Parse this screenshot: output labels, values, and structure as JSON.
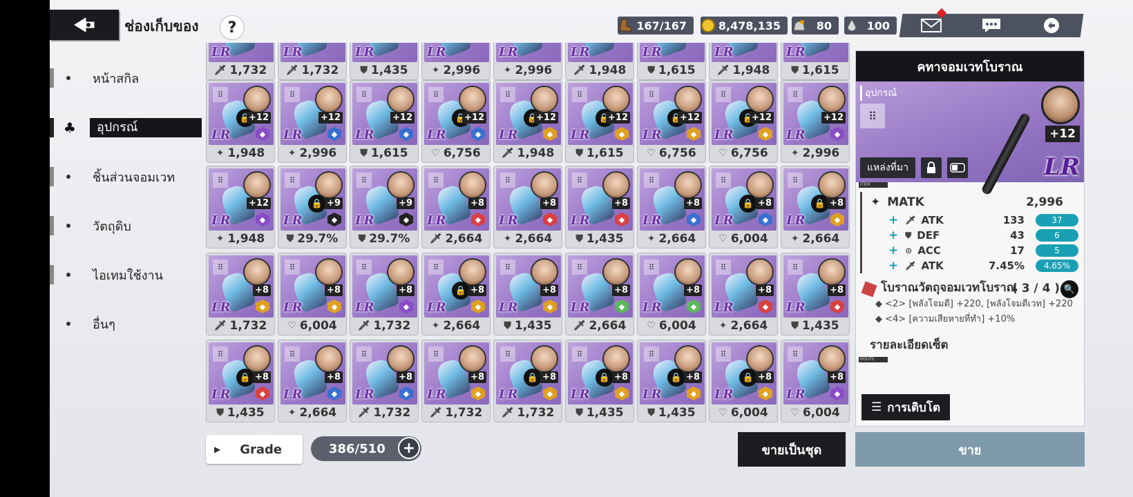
{
  "header": {
    "title": "ช่องเก็บของ",
    "help_label": "?",
    "resources": [
      {
        "icon": "boot-icon",
        "value": "167/167"
      },
      {
        "icon": "gold-coin-icon",
        "value": "8,478,135"
      },
      {
        "icon": "ore-bag-icon",
        "value": "80"
      },
      {
        "icon": "crystal-drop-icon",
        "value": "100"
      }
    ],
    "buttons": [
      "mail-icon",
      "chat-icon",
      "return-icon"
    ]
  },
  "sidebar": {
    "items": [
      {
        "label": "หน้าสกิล",
        "active": false
      },
      {
        "label": "อุปกรณ์",
        "active": true
      },
      {
        "label": "ชิ้นส่วนจอมเวท",
        "active": false
      },
      {
        "label": "วัตถุดิบ",
        "active": false
      },
      {
        "label": "ไอเทมใช้งาน",
        "active": false
      },
      {
        "label": "อื่นๆ",
        "active": false
      }
    ]
  },
  "grid": {
    "rows": [
      [
        {
          "stat": "1,732",
          "icon": "sword",
          "locked": false,
          "level": "",
          "badge": ""
        },
        {
          "stat": "1,732",
          "icon": "sword",
          "locked": false,
          "level": "",
          "badge": ""
        },
        {
          "stat": "1,435",
          "icon": "shield",
          "locked": false,
          "level": "",
          "badge": ""
        },
        {
          "stat": "2,996",
          "icon": "star",
          "locked": false,
          "level": "",
          "badge": ""
        },
        {
          "stat": "2,996",
          "icon": "star",
          "locked": false,
          "level": "",
          "badge": ""
        },
        {
          "stat": "1,948",
          "icon": "sword",
          "locked": false,
          "level": "",
          "badge": ""
        },
        {
          "stat": "1,615",
          "icon": "shield",
          "locked": false,
          "level": "",
          "badge": ""
        },
        {
          "stat": "1,948",
          "icon": "sword",
          "locked": false,
          "level": "",
          "badge": ""
        },
        {
          "stat": "1,615",
          "icon": "shield",
          "locked": false,
          "level": "",
          "badge": ""
        }
      ],
      [
        {
          "stat": "1,948",
          "icon": "star",
          "locked": true,
          "level": "+12",
          "badge": "#8a4cc7"
        },
        {
          "stat": "2,996",
          "icon": "star",
          "locked": false,
          "level": "+12",
          "badge": "#3a6fcf"
        },
        {
          "stat": "1,615",
          "icon": "shield",
          "locked": false,
          "level": "+12",
          "badge": "#3a6fcf"
        },
        {
          "stat": "6,756",
          "icon": "heart",
          "locked": true,
          "level": "+12",
          "badge": "#3a6fcf"
        },
        {
          "stat": "1,948",
          "icon": "sword",
          "locked": true,
          "level": "+12",
          "badge": "#e0a020"
        },
        {
          "stat": "1,615",
          "icon": "shield",
          "locked": true,
          "level": "+12",
          "badge": "#e0a020"
        },
        {
          "stat": "6,756",
          "icon": "heart",
          "locked": true,
          "level": "+12",
          "badge": "#e0a020"
        },
        {
          "stat": "6,756",
          "icon": "heart",
          "locked": true,
          "level": "+12",
          "badge": "#e0a020"
        },
        {
          "stat": "2,996",
          "icon": "star",
          "locked": false,
          "level": "+12",
          "badge": "#8a4cc7"
        }
      ],
      [
        {
          "stat": "1,948",
          "icon": "star",
          "locked": false,
          "level": "+12",
          "badge": "#8a4cc7"
        },
        {
          "stat": "29.7%",
          "icon": "shield",
          "locked": true,
          "level": "+9",
          "badge": "#222222"
        },
        {
          "stat": "29.7%",
          "icon": "shield",
          "locked": false,
          "level": "+9",
          "badge": "#222222"
        },
        {
          "stat": "2,664",
          "icon": "sword",
          "locked": false,
          "level": "+8",
          "badge": "#d94040"
        },
        {
          "stat": "2,664",
          "icon": "star",
          "locked": false,
          "level": "+8",
          "badge": "#d94040"
        },
        {
          "stat": "1,435",
          "icon": "shield",
          "locked": false,
          "level": "+8",
          "badge": "#d94040"
        },
        {
          "stat": "2,664",
          "icon": "star",
          "locked": false,
          "level": "+8",
          "badge": "#3a6fcf"
        },
        {
          "stat": "6,004",
          "icon": "heart",
          "locked": true,
          "level": "+8",
          "badge": "#3a6fcf"
        },
        {
          "stat": "2,664",
          "icon": "star",
          "locked": true,
          "level": "+8",
          "badge": "#e0a020"
        }
      ],
      [
        {
          "stat": "1,732",
          "icon": "sword",
          "locked": false,
          "level": "+8",
          "badge": "#e0a020"
        },
        {
          "stat": "6,004",
          "icon": "heart",
          "locked": false,
          "level": "+8",
          "badge": "#e0a020"
        },
        {
          "stat": "1,732",
          "icon": "sword",
          "locked": false,
          "level": "+8",
          "badge": "#8a4cc7"
        },
        {
          "stat": "2,664",
          "icon": "star",
          "locked": true,
          "level": "+8",
          "badge": "#e0a020"
        },
        {
          "stat": "1,435",
          "icon": "shield",
          "locked": false,
          "level": "+8",
          "badge": "#e0a020"
        },
        {
          "stat": "2,664",
          "icon": "sword",
          "locked": false,
          "level": "+8",
          "badge": "#5cb85c"
        },
        {
          "stat": "6,004",
          "icon": "heart",
          "locked": false,
          "level": "+8",
          "badge": "#5cb85c"
        },
        {
          "stat": "2,664",
          "icon": "star",
          "locked": false,
          "level": "+8",
          "badge": "#d94040"
        },
        {
          "stat": "1,435",
          "icon": "shield",
          "locked": false,
          "level": "+8",
          "badge": "#d94040"
        }
      ],
      [
        {
          "stat": "1,435",
          "icon": "shield",
          "locked": true,
          "level": "+8",
          "badge": "#d94040"
        },
        {
          "stat": "2,664",
          "icon": "star",
          "locked": false,
          "level": "+8",
          "badge": "#3a6fcf"
        },
        {
          "stat": "1,732",
          "icon": "sword",
          "locked": false,
          "level": "+8",
          "badge": "#3a6fcf"
        },
        {
          "stat": "1,732",
          "icon": "sword",
          "locked": false,
          "level": "+8",
          "badge": "#e0a020"
        },
        {
          "stat": "1,732",
          "icon": "sword",
          "locked": true,
          "level": "+8",
          "badge": "#e0a020"
        },
        {
          "stat": "1,435",
          "icon": "shield",
          "locked": true,
          "level": "+8",
          "badge": "#e0a020"
        },
        {
          "stat": "1,435",
          "icon": "shield",
          "locked": true,
          "level": "+8",
          "badge": "#e0a020"
        },
        {
          "stat": "6,004",
          "icon": "heart",
          "locked": true,
          "level": "+8",
          "badge": "#e0a020"
        },
        {
          "stat": "6,004",
          "icon": "heart",
          "locked": false,
          "level": "+8",
          "badge": "#8a4cc7"
        }
      ]
    ]
  },
  "bottom": {
    "grade_label": "Grade",
    "count": "386/510",
    "sell_set_label": "ขายเป็นชุด",
    "sell_label": "ขาย"
  },
  "detail": {
    "name": "คทาจอมเวทโบราณ",
    "category": "อุปกรณ์",
    "level": "+12",
    "rarity": "LR",
    "source_label": "แหล่งที่มา",
    "section_item_tag": "ITEM",
    "section_route_tag": "ROUTE",
    "main_stat": {
      "name": "MATK",
      "value": "2,996"
    },
    "sub_stats": [
      {
        "icon": "sword",
        "name": "ATK",
        "value": "133",
        "bonus": "37"
      },
      {
        "icon": "shield",
        "name": "DEF",
        "value": "43",
        "bonus": "6"
      },
      {
        "icon": "target",
        "name": "ACC",
        "value": "17",
        "bonus": "5"
      },
      {
        "icon": "sword",
        "name": "ATK",
        "value": "7.45%",
        "bonus": "4.65%"
      }
    ],
    "set_name": "โบราณวัตถุจอมเวทโบราณ",
    "set_count": "( 3 / 4 )",
    "set_effects": [
      {
        "tag": "<2>",
        "text": "[พลังโจมตี] +220, [พลังโจมตีเวท] +220"
      },
      {
        "tag": "<4>",
        "text": "[ความเสียหายที่ทำ] +10%"
      }
    ],
    "set_detail_label": "รายละเอียดเซ็ต",
    "growth_label": "การเติบโต"
  }
}
